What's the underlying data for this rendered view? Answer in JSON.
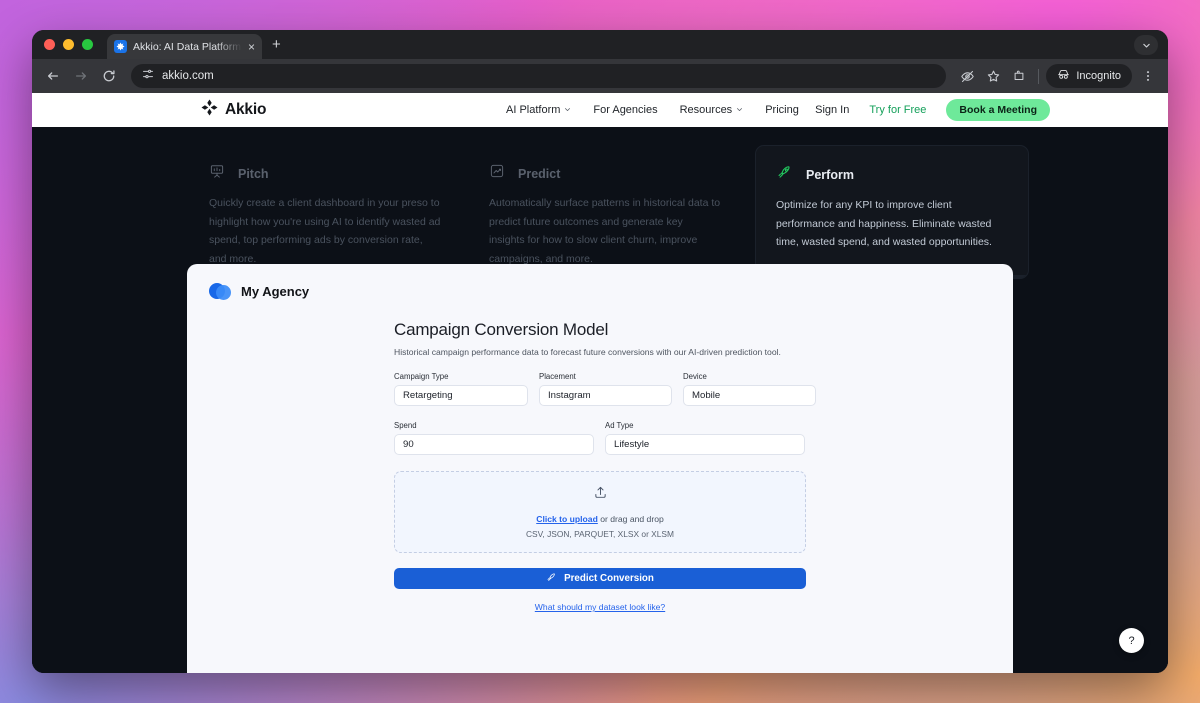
{
  "browser": {
    "tab": {
      "title": "Akkio: AI Data Platform for Ag",
      "favicon_icon": "akkio-logo-icon",
      "close_icon": "close-icon"
    },
    "new_tab_icon": "plus-icon",
    "tab_list_icon": "chevron-down-icon",
    "back_icon": "back-arrow-icon",
    "forward_icon": "forward-arrow-icon",
    "reload_icon": "reload-icon",
    "site_settings_icon": "tune-icon",
    "url": "akkio.com",
    "toolbar": {
      "tracking_protection_icon": "eye-slash-icon",
      "bookmark_icon": "star-icon",
      "extensions_icon": "extensions-icon",
      "incognito_label": "Incognito",
      "incognito_icon": "incognito-hat-icon",
      "menu_icon": "kebab-menu-icon"
    }
  },
  "sitenav": {
    "brand": "Akkio",
    "brand_icon": "akkio-diamond-logo",
    "links": [
      {
        "label": "AI Platform",
        "caret": "chevron-down-icon"
      },
      {
        "label": "For Agencies",
        "caret": ""
      },
      {
        "label": "Resources",
        "caret": "chevron-down-icon"
      },
      {
        "label": "Pricing",
        "caret": ""
      }
    ],
    "sign_in": "Sign In",
    "try_free": "Try for Free",
    "book_meeting": "Book a Meeting"
  },
  "cards": [
    {
      "icon": "presentation-board-icon",
      "title": "Pitch",
      "body": "Quickly create a client dashboard in your preso to highlight how you're using AI to identify wasted ad spend, top performing ads by conversion rate, and more."
    },
    {
      "icon": "chart-trend-icon",
      "title": "Predict",
      "body": "Automatically surface patterns in historical data to predict future outcomes and generate key insights for how to slow client churn, improve campaigns, and more."
    },
    {
      "icon": "rocket-icon",
      "title": "Perform",
      "body": "Optimize for any KPI to improve client performance and happiness. Eliminate wasted time, wasted spend, and wasted opportunities."
    }
  ],
  "panel": {
    "agency_name": "My Agency",
    "agency_logo_icon": "overlapping-circles-logo",
    "form_title": "Campaign Conversion Model",
    "form_subtitle": "Historical campaign performance data to forecast future conversions with our AI-driven prediction tool.",
    "fields": {
      "campaign_type": {
        "label": "Campaign Type",
        "value": "Retargeting"
      },
      "placement": {
        "label": "Placement",
        "value": "Instagram"
      },
      "device": {
        "label": "Device",
        "value": "Mobile"
      },
      "spend": {
        "label": "Spend",
        "value": "90"
      },
      "ad_type": {
        "label": "Ad Type",
        "value": "Lifestyle"
      }
    },
    "dropzone": {
      "icon": "upload-icon",
      "link_text": "Click to upload",
      "rest_text": " or drag and drop",
      "formats": "CSV, JSON, PARQUET, XLSX or XLSM"
    },
    "predict_button": {
      "label": "Predict Conversion",
      "icon": "rocket-icon"
    },
    "dataset_link": "What should my dataset look like?"
  },
  "help_button": {
    "label": "?",
    "icon": "question-mark-icon"
  },
  "colors": {
    "accent_blue": "#1a5fd6",
    "link_blue": "#2563eb",
    "brand_green": "#6ee99a",
    "try_free_green": "#14a05a",
    "progress_green": "#22c55e",
    "panel_bg": "#f7f8fc",
    "hero_bg": "#0c1017"
  }
}
